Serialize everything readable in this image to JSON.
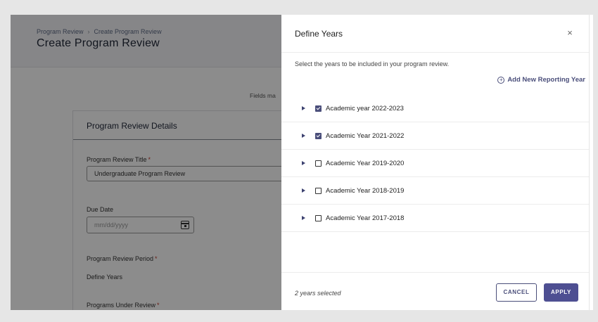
{
  "page": {
    "breadcrumb": [
      "Program Review",
      "Create Program Review"
    ],
    "breadcrumb_sep": "›",
    "title": "Create Program Review",
    "fields_note": "Fields ma",
    "card": {
      "title": "Program Review Details",
      "review_title_label": "Program Review Title",
      "required_mark": "*",
      "review_title_value": "Undergraduate Program Review",
      "due_date_label": "Due Date",
      "due_date_placeholder": "mm/dd/yyyy",
      "period_label": "Program Review Period",
      "define_years_link": "Define Years",
      "programs_label": "Programs Under Review"
    }
  },
  "drawer": {
    "title": "Define Years",
    "close_symbol": "×",
    "instructions": "Select the years to be included in your program review.",
    "add_year_label": "Add New Reporting Year",
    "add_year_symbol": "+",
    "years": [
      {
        "label": "Academic year 2022-2023",
        "checked": true
      },
      {
        "label": "Academic Year 2021-2022",
        "checked": true
      },
      {
        "label": "Academic Year 2019-2020",
        "checked": false
      },
      {
        "label": "Academic Year 2018-2019",
        "checked": false
      },
      {
        "label": "Academic Year 2017-2018",
        "checked": false
      }
    ],
    "footer": {
      "selected_count": "2 years selected",
      "cancel_label": "CANCEL",
      "apply_label": "APPLY"
    }
  },
  "colors": {
    "accent": "#4e4f92",
    "overlay": "rgba(0,0,0,0.45)",
    "required": "#c0392b"
  }
}
